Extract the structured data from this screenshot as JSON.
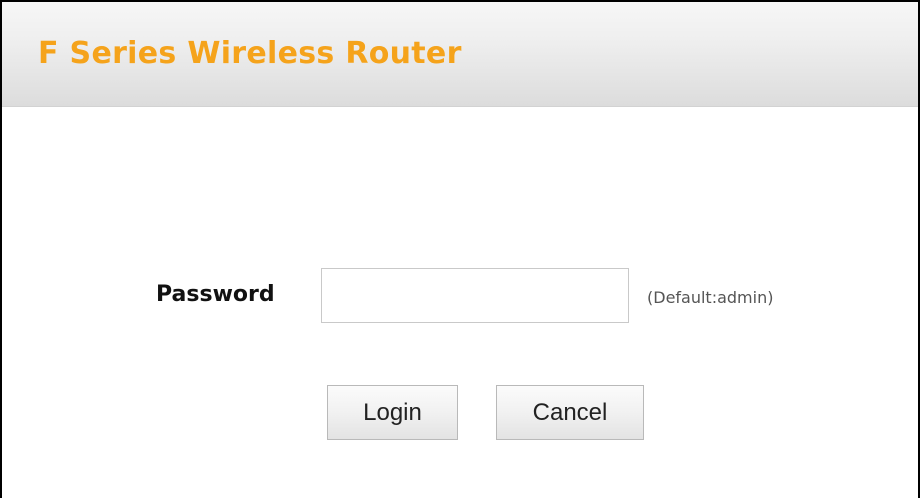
{
  "header": {
    "title": "F Series Wireless Router"
  },
  "login_form": {
    "password_label": "Password",
    "password_value": "",
    "password_hint": "(Default:admin)",
    "login_label": "Login",
    "cancel_label": "Cancel"
  },
  "colors": {
    "title": "#f5a31b",
    "header_bg": "#e6e6e6",
    "page_bg": "#ffffff"
  }
}
